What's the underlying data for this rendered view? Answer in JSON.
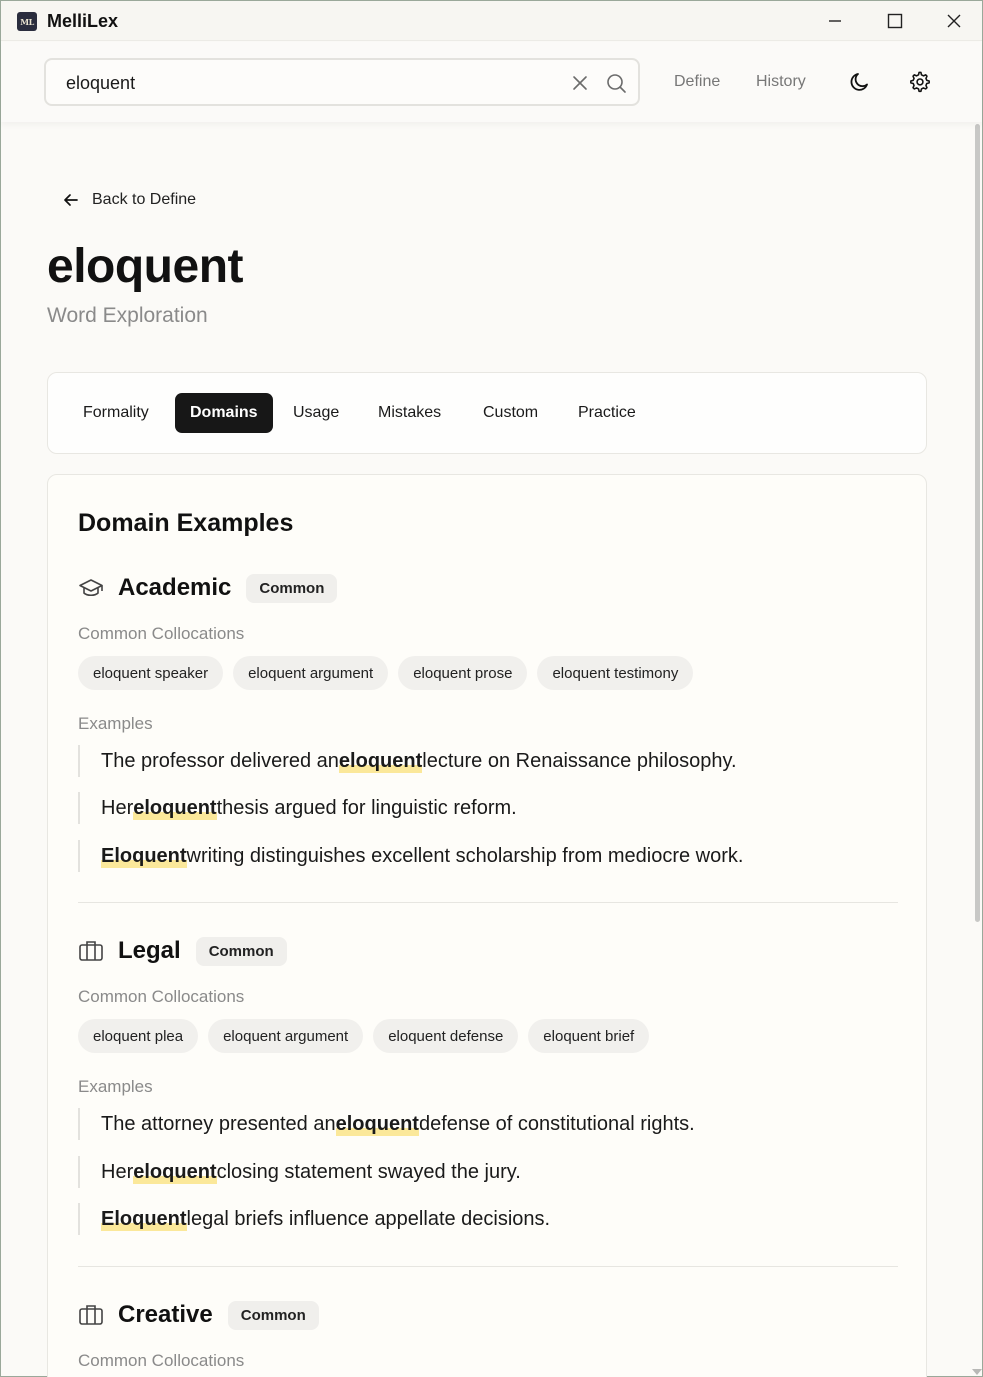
{
  "app": {
    "icon_text": "ML",
    "title": "MelliLex"
  },
  "search": {
    "value": "eloquent"
  },
  "nav": {
    "define": "Define",
    "history": "History"
  },
  "back_label": "Back to Define",
  "word": {
    "title": "eloquent",
    "subtitle": "Word Exploration"
  },
  "tabs": [
    {
      "label": "Formality",
      "active": false
    },
    {
      "label": "Domains",
      "active": true
    },
    {
      "label": "Usage",
      "active": false
    },
    {
      "label": "Mistakes",
      "active": false
    },
    {
      "label": "Custom",
      "active": false
    },
    {
      "label": "Practice",
      "active": false
    }
  ],
  "card_title": "Domain Examples",
  "labels": {
    "collocations": "Common Collocations",
    "examples": "Examples"
  },
  "domains": [
    {
      "name": "Academic",
      "icon": "graduation-cap-icon",
      "badge": "Common",
      "collocations": [
        "eloquent speaker",
        "eloquent argument",
        "eloquent prose",
        "eloquent testimony"
      ],
      "examples": [
        {
          "before": "The professor delivered an ",
          "word": "eloquent",
          "after": " lecture on Renaissance philosophy."
        },
        {
          "before": "Her ",
          "word": "eloquent",
          "after": " thesis argued for linguistic reform."
        },
        {
          "before": "",
          "word": "Eloquent",
          "after": " writing distinguishes excellent scholarship from mediocre work."
        }
      ]
    },
    {
      "name": "Legal",
      "icon": "briefcase-icon",
      "badge": "Common",
      "collocations": [
        "eloquent plea",
        "eloquent argument",
        "eloquent defense",
        "eloquent brief"
      ],
      "examples": [
        {
          "before": "The attorney presented an ",
          "word": "eloquent",
          "after": " defense of constitutional rights."
        },
        {
          "before": "Her ",
          "word": "eloquent",
          "after": " closing statement swayed the jury."
        },
        {
          "before": "",
          "word": "Eloquent",
          "after": " legal briefs influence appellate decisions."
        }
      ]
    },
    {
      "name": "Creative",
      "icon": "briefcase-icon",
      "badge": "Common",
      "collocations": [],
      "examples": []
    }
  ],
  "colors": {
    "accent": "#171717",
    "highlight": "#fbe89a",
    "muted": "#8a8a8a"
  }
}
